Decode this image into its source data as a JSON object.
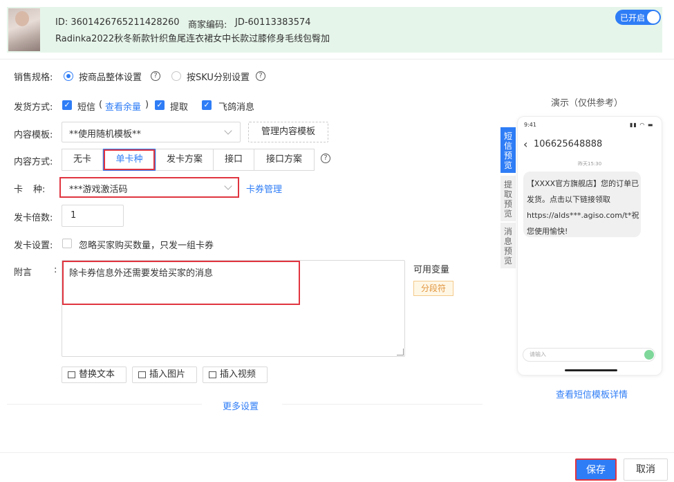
{
  "header": {
    "id_text": "ID: 3601426765211428260",
    "code_label": "商家编码:",
    "code_value": "JD-60113383574",
    "product_title": "Radinka2022秋冬新款针织鱼尾连衣裙女中长款过膝修身毛线包臀加",
    "toggle_label": "已开启"
  },
  "spec": {
    "label": "销售规格:",
    "option_whole": "按商品整体设置",
    "option_sku": "按SKU分别设置"
  },
  "delivery": {
    "label": "发货方式:",
    "sms": "短信",
    "paren_open": "(",
    "check_balance": "查看余量",
    "paren_close": ")",
    "pickup": "提取",
    "feige": "飞鸽消息"
  },
  "template": {
    "label": "内容模板:",
    "value": "**使用随机模板**",
    "manage_btn": "管理内容模板"
  },
  "content_mode": {
    "label": "内容方式:",
    "tabs": [
      "无卡",
      "单卡种",
      "发卡方案",
      "接口",
      "接口方案"
    ]
  },
  "card_type": {
    "label_a": "卡",
    "label_b": "种:",
    "value": "***游戏激活码",
    "manage_link": "卡券管理"
  },
  "multiplier": {
    "label": "发卡倍数:",
    "value": "1"
  },
  "card_setting": {
    "label": "发卡设置:",
    "option": "忽略买家购买数量，只发一组卡券"
  },
  "note": {
    "label_a": "附言",
    "label_b": ":",
    "value": "除卡券信息外还需要发给买家的消息",
    "vars_label": "可用变量",
    "segment_tag": "分段符"
  },
  "tools": {
    "replace": "替换文本",
    "image": "插入图片",
    "video": "插入视频"
  },
  "more_settings": "更多设置",
  "preview": {
    "title": "演示（仅供参考）",
    "tabs": [
      "短信预览",
      "提取预览",
      "消息预览"
    ],
    "time": "9:41",
    "phone_number": "106625648888",
    "date": "昨天15:30",
    "message": "【XXXX官方旗舰店】您的订单已发货。点击以下链接领取https://alds***.agiso.com/t*祝您使用愉快!",
    "input_placeholder": "请输入",
    "detail_link": "查看短信模板详情"
  },
  "footer": {
    "save": "保存",
    "cancel": "取消"
  },
  "colors": {
    "accent": "#2f7df6",
    "highlight_red": "#e0343f",
    "header_bg": "#e6f5ea",
    "tag_orange": "#e0943d"
  }
}
